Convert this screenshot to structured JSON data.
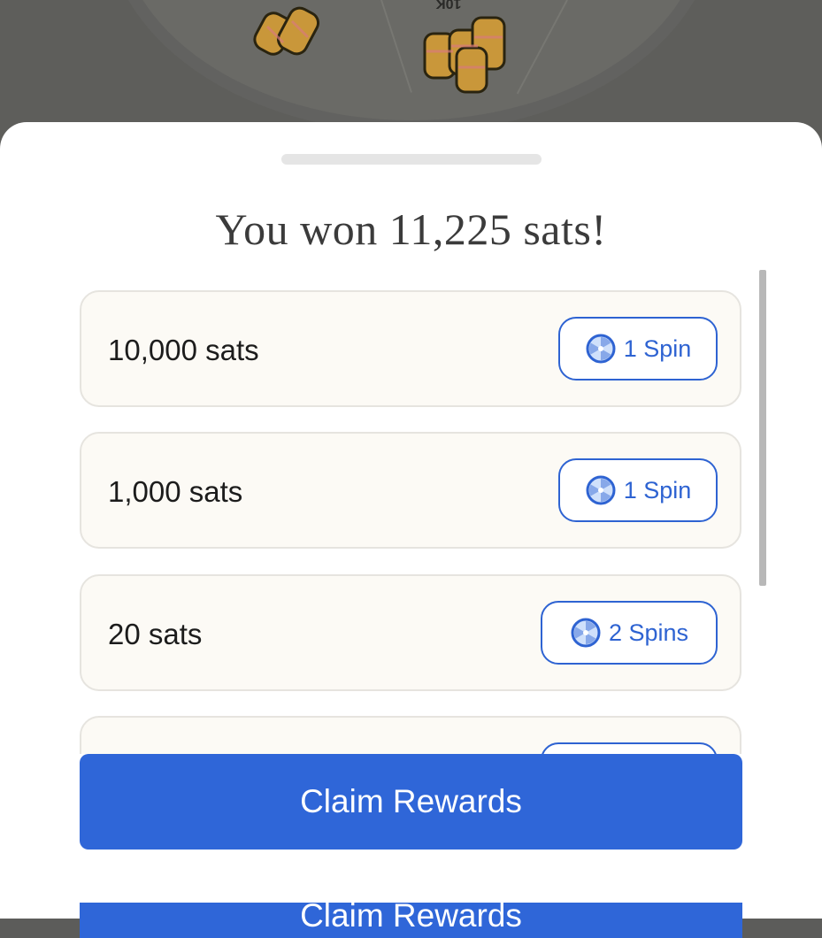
{
  "wheel": {
    "segment_label": "10K"
  },
  "sheet": {
    "title": "You won 11,225 sats!"
  },
  "rewards": [
    {
      "amount": "10,000 sats",
      "spins": "1 Spin"
    },
    {
      "amount": "1,000 sats",
      "spins": "1 Spin"
    },
    {
      "amount": "20 sats",
      "spins": "2 Spins"
    },
    {
      "amount": "",
      "spins": ""
    }
  ],
  "actions": {
    "claim_label": "Claim Rewards",
    "claim_label_duplicate": "Claim Rewards"
  },
  "colors": {
    "accent": "#2f66d8",
    "card_bg": "#fcfaf5",
    "coin": "#e0a63a"
  },
  "icons": {
    "spin": "spin-wheel-icon",
    "coins": "coin-stack-icon"
  }
}
